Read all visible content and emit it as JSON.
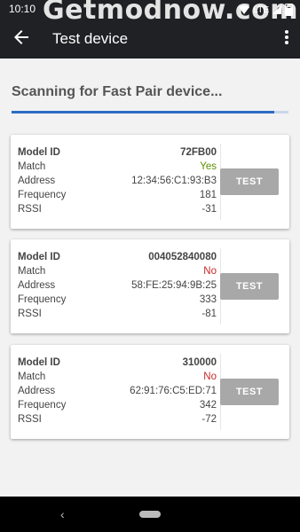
{
  "statusbar": {
    "time": "10:10",
    "watermark": "Getmodnow.com",
    "network": "LTE"
  },
  "appbar": {
    "title": "Test device"
  },
  "scanning": {
    "text": "Scanning for Fast Pair device...",
    "progress": 0.95
  },
  "labels": {
    "model_id": "Model ID",
    "match": "Match",
    "address": "Address",
    "frequency": "Frequency",
    "rssi": "RSSI"
  },
  "devices": [
    {
      "model_id": "72FB00",
      "match": "Yes",
      "address": "12:34:56:C1:93:B3",
      "frequency": "181",
      "rssi": "-31",
      "test_label": "TEST"
    },
    {
      "model_id": "004052840080",
      "match": "No",
      "address": "58:FE:25:94:9B:25",
      "frequency": "333",
      "rssi": "-81",
      "test_label": "TEST"
    },
    {
      "model_id": "310000",
      "match": "No",
      "address": "62:91:76:C5:ED:71",
      "frequency": "342",
      "rssi": "-72",
      "test_label": "TEST"
    }
  ],
  "colors": {
    "match_yes": "#5a8f00",
    "match_no": "#c62828",
    "accent": "#2b6cc4"
  },
  "icons": {
    "back": "arrow-left-icon",
    "more": "more-vert-icon",
    "wifi": "wifi-icon",
    "signal": "signal-icon",
    "battery": "battery-icon"
  }
}
